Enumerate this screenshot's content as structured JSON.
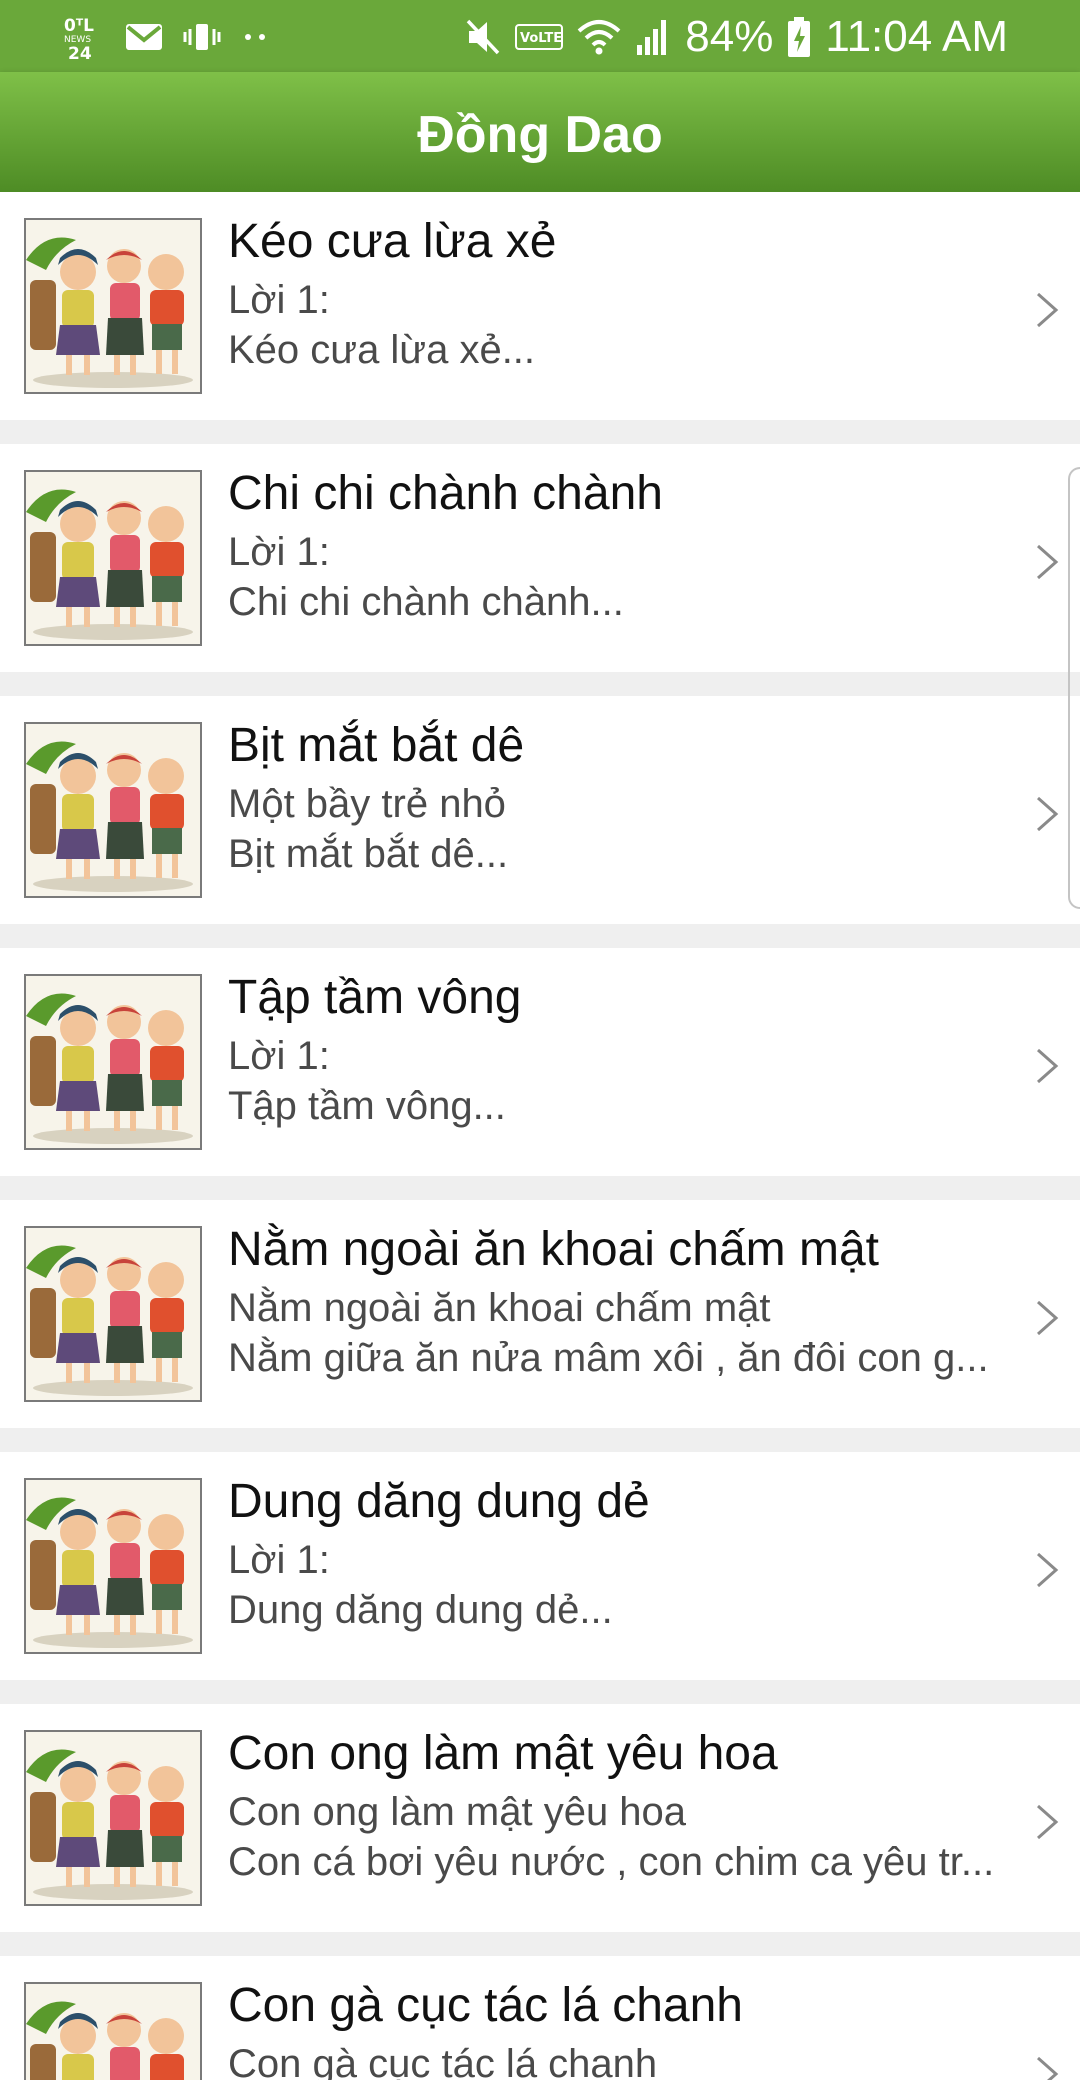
{
  "status_bar": {
    "news_icon_label": "24",
    "battery_percent": "84%",
    "time": "11:04 AM",
    "icons": [
      "news24-icon",
      "mail-icon",
      "vibrate-icon",
      "more-dots-icon",
      "mute-icon",
      "volte-icon",
      "wifi-icon",
      "signal-icon",
      "battery-charging-icon"
    ]
  },
  "app_bar": {
    "title": "Đồng Dao"
  },
  "colors": {
    "status_bar": "#6aa83a",
    "app_bar_top": "#7fc048",
    "app_bar_bottom": "#4e8c25"
  },
  "songs": [
    {
      "title": "Kéo cưa lừa xẻ",
      "line1": "Lời 1:",
      "line2": "Kéo cưa lừa xẻ..."
    },
    {
      "title": "Chi chi chành chành",
      "line1": "Lời 1:",
      "line2": "Chi chi chành chành..."
    },
    {
      "title": "Bịt mắt bắt dê",
      "line1": "Một bầy trẻ nhỏ",
      "line2": "Bịt mắt bắt dê..."
    },
    {
      "title": "Tập tầm vông",
      "line1": "Lời 1:",
      "line2": "Tập tầm vông..."
    },
    {
      "title": "Nằm ngoài ăn khoai chấm mật",
      "line1": "Nằm ngoài ăn khoai chấm mật",
      "line2": "Nằm giữa ăn nửa mâm xôi , ăn đôi con g..."
    },
    {
      "title": "Dung dăng dung dẻ",
      "line1": "Lời 1:",
      "line2": "Dung dăng dung dẻ..."
    },
    {
      "title": "Con ong làm mật yêu hoa",
      "line1": "Con ong làm mật yêu hoa",
      "line2": "Con cá bơi yêu nước , con chim ca yêu tr..."
    },
    {
      "title": "Con gà cục tác lá chanh",
      "line1": "Con gà cục tác lá chanh",
      "line2": ""
    }
  ]
}
